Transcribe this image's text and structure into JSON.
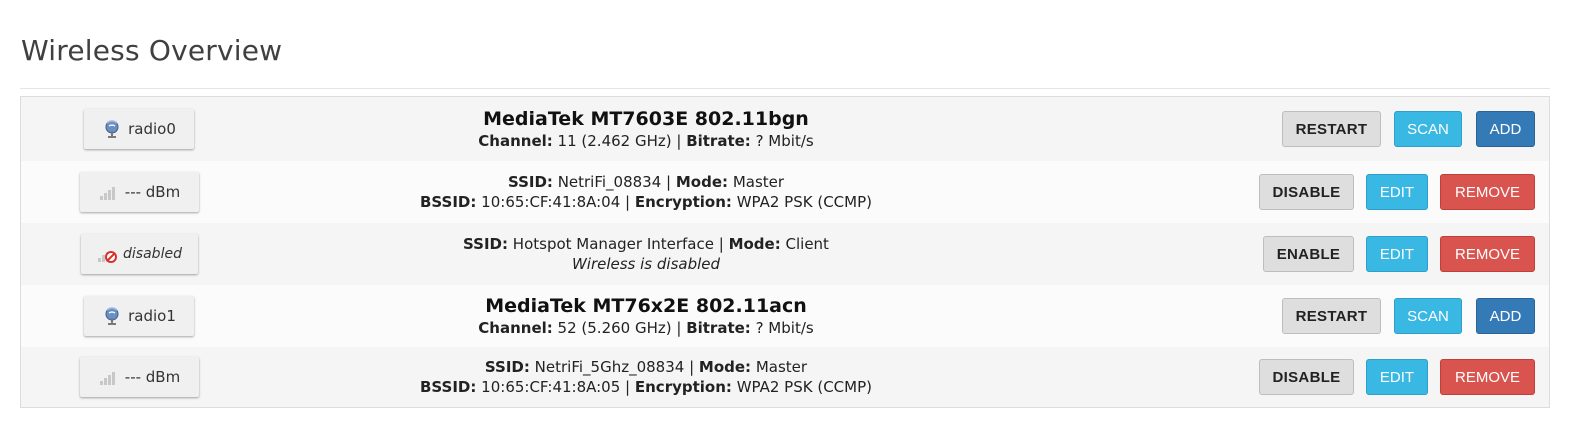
{
  "page": {
    "title": "Wireless Overview"
  },
  "colors": {
    "restart_button": "#dedede",
    "scan_button": "#39b8e3",
    "add_button": "#337ab7",
    "edit_button": "#39b8e3",
    "remove_button": "#d9534f"
  },
  "radios": [
    {
      "badge_icon": "wireless-radio-icon",
      "badge_label": "radio0",
      "title": "MediaTek MT7603E 802.11bgn",
      "channel_label": "Channel:",
      "channel_value": "11 (2.462 GHz)",
      "bitrate_label": "Bitrate:",
      "bitrate_value": "? Mbit/s",
      "restart_label": "RESTART",
      "scan_label": "SCAN",
      "add_label": "ADD"
    },
    {
      "badge_icon": "wireless-radio-icon",
      "badge_label": "radio1",
      "title": "MediaTek MT76x2E 802.11acn",
      "channel_label": "Channel:",
      "channel_value": "52 (5.260 GHz)",
      "bitrate_label": "Bitrate:",
      "bitrate_value": "? Mbit/s",
      "restart_label": "RESTART",
      "scan_label": "SCAN",
      "add_label": "ADD"
    }
  ],
  "networks": [
    {
      "badge_icon": "signal-bars-icon",
      "badge_label": "--- dBm",
      "ssid_label": "SSID:",
      "ssid_value": "NetriFi_08834",
      "mode_label": "Mode:",
      "mode_value": "Master",
      "bssid_label": "BSSID:",
      "bssid_value": "10:65:CF:41:8A:04",
      "encryption_label": "Encryption:",
      "encryption_value": "WPA2 PSK (CCMP)",
      "toggle_label": "DISABLE",
      "edit_label": "EDIT",
      "remove_label": "REMOVE"
    },
    {
      "badge_icon": "signal-disabled-icon",
      "badge_label": "disabled",
      "ssid_label": "SSID:",
      "ssid_value": "Hotspot Manager Interface",
      "mode_label": "Mode:",
      "mode_value": "Client",
      "status_text": "Wireless is disabled",
      "toggle_label": "ENABLE",
      "edit_label": "EDIT",
      "remove_label": "REMOVE"
    },
    {
      "badge_icon": "signal-bars-icon",
      "badge_label": "--- dBm",
      "ssid_label": "SSID:",
      "ssid_value": "NetriFi_5Ghz_08834",
      "mode_label": "Mode:",
      "mode_value": "Master",
      "bssid_label": "BSSID:",
      "bssid_value": "10:65:CF:41:8A:05",
      "encryption_label": "Encryption:",
      "encryption_value": "WPA2 PSK (CCMP)",
      "toggle_label": "DISABLE",
      "edit_label": "EDIT",
      "remove_label": "REMOVE"
    }
  ]
}
